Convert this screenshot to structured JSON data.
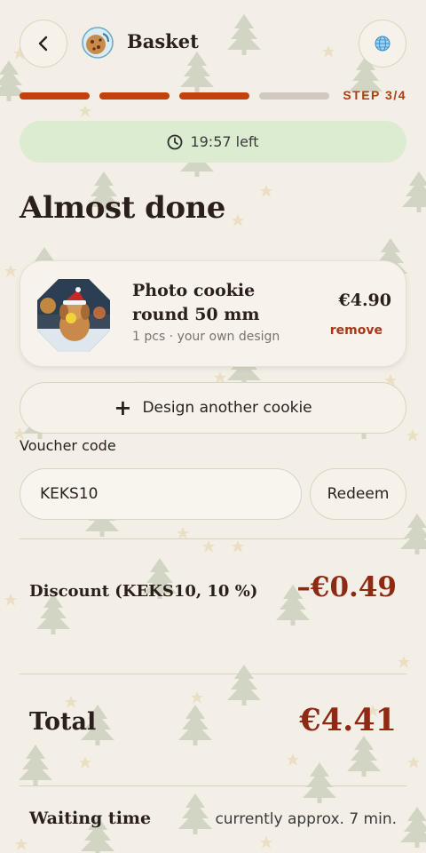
{
  "header": {
    "title": "Basket",
    "back_icon": "chevron-left-icon",
    "language_icon": "globe-icon"
  },
  "progress": {
    "current_step": 3,
    "total_steps": 4,
    "label": "STEP 3/4",
    "active_color": "#c2410c",
    "inactive_color": "#cfc9bf"
  },
  "timer": {
    "text": "19:57 left",
    "icon": "clock-icon"
  },
  "page": {
    "title": "Almost done"
  },
  "basket": {
    "items": [
      {
        "name": "Photo cookie round 50 mm",
        "meta": "1 pcs · your own design",
        "price": "€4.90",
        "remove_label": "remove"
      }
    ]
  },
  "actions": {
    "design_another_label": "Design another cookie"
  },
  "voucher": {
    "label": "Voucher code",
    "value": "KEKS10",
    "placeholder": "",
    "redeem_label": "Redeem"
  },
  "summary": {
    "discount_label": "Discount (KEKS10, 10 %)",
    "discount_value": "–€0.49",
    "total_label": "Total",
    "total_value": "€4.41",
    "waiting_label": "Waiting time",
    "waiting_value": "currently approx. 7 min."
  },
  "colors": {
    "background": "#f3efe7",
    "accent": "#c2410c",
    "price_accent": "#8e2a14",
    "timer_bg": "#dcecd1"
  }
}
